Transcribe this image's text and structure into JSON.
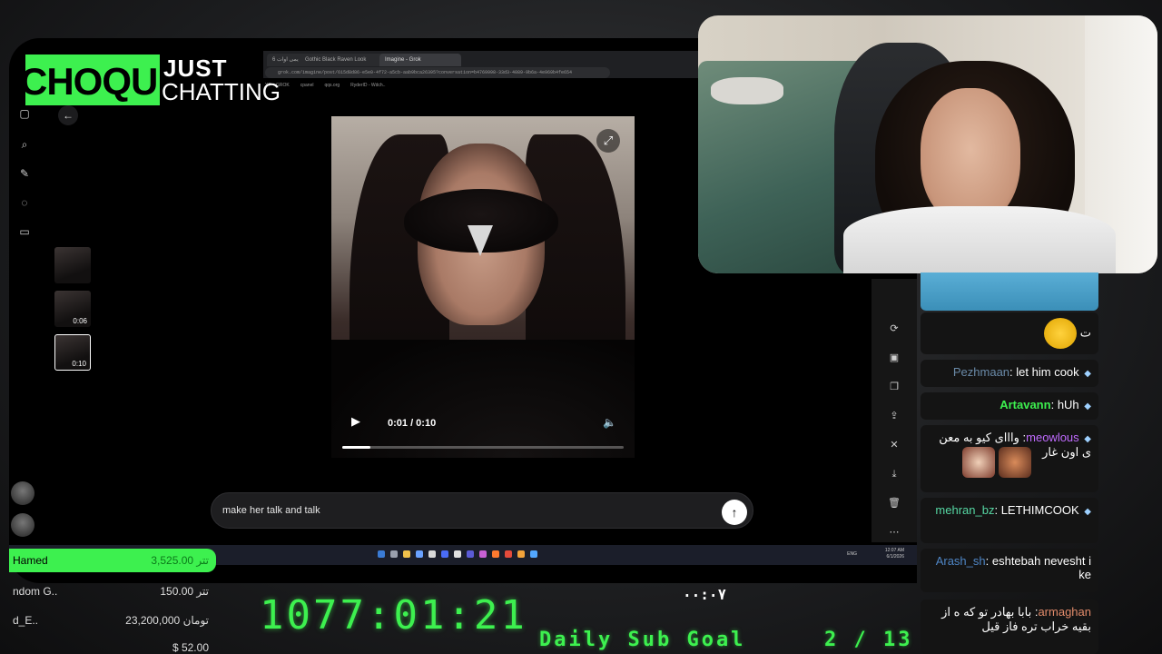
{
  "overlay": {
    "category_name_fragment": "CHOQU",
    "category_just": "JUST",
    "category_chatting": "CHATTING",
    "uptime": "1077:01:21",
    "timer": "۰۰:۰۷",
    "goal_label": "Daily Sub Goal",
    "goal_count": "2 / 13"
  },
  "browser": {
    "tabs": [
      "یمی اوات 6",
      "Gothic Black Raven Look",
      "Imagine - Grok"
    ],
    "url": "grok.com/imagine/post/615d8d86-e5e0-4f72-a5cb-aab9bca26395?conversation=b4769998-33d3-4089-9b6a-4e969b4fe654",
    "bookmarks": [
      "YT + GROK",
      "cpanel",
      "qqs.org",
      "RyderID - Wdch.."
    ]
  },
  "grok": {
    "thumbnails": [
      {
        "duration": ""
      },
      {
        "duration": "0:06"
      },
      {
        "duration": "0:10"
      }
    ],
    "video": {
      "time_label": "0:01 / 0:10",
      "progress": 0.1
    },
    "prompt": "make her talk and talk"
  },
  "taskbar": {
    "clock_time": "12:07 AM",
    "clock_date": "6/1/2026",
    "lang": "ENG"
  },
  "chat": {
    "messages": [
      {
        "user": "",
        "text": "ت",
        "has_emote": true,
        "user_color": "#ffffff"
      },
      {
        "user": "Pezhmaan",
        "text": "let him cook",
        "user_color": "#6a8aa8"
      },
      {
        "user": "Artavann",
        "text": "hUh",
        "user_color": "#3df04f"
      },
      {
        "user": "meowlous",
        "text": "وااای کیو به معن ی اون غار",
        "user_color": "#c06bff"
      },
      {
        "user": "mehran_bz",
        "text": "LETHIMCOOK",
        "user_color": "#56d8a4"
      },
      {
        "user": "Arash_sh",
        "text": "eshtebah nevesht i ke",
        "user_color": "#4f86c6"
      },
      {
        "user": "armaghan",
        "text": "بابا بهادر تو که ه از بقیه خراب تره فاز قیل",
        "user_color": "#e08a6a"
      }
    ]
  },
  "donations": [
    {
      "name": "Hamed",
      "amount": "3,525.00 تتر"
    },
    {
      "name": "ndom G..",
      "amount": "150.00 تتر"
    },
    {
      "name": "d_E..",
      "amount": "23,200,000 تومان"
    },
    {
      "name": "",
      "amount": "$ 52.00"
    }
  ]
}
